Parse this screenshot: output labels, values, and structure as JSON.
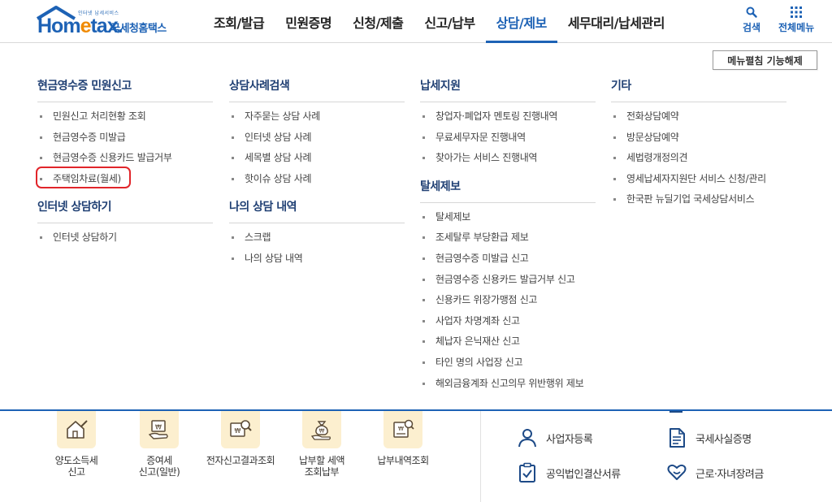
{
  "header": {
    "logo": {
      "small_text": "인터넷 납세서비스",
      "word_prefix": "Hom",
      "word_e": "e",
      "word_suffix": "tax.",
      "kr_text": "국세청홈택스"
    },
    "nav": [
      {
        "label": "조회/발급",
        "active": false
      },
      {
        "label": "민원증명",
        "active": false
      },
      {
        "label": "신청/제출",
        "active": false
      },
      {
        "label": "신고/납부",
        "active": false
      },
      {
        "label": "상담/제보",
        "active": true
      },
      {
        "label": "세무대리/납세관리",
        "active": false
      }
    ],
    "utility": {
      "search_label": "검색",
      "search_icon": "search-icon",
      "all_menu_label": "전체메뉴",
      "all_menu_icon": "grid-icon"
    }
  },
  "menu_toggle_label": "메뉴펼침 기능해제",
  "menu": {
    "col1": [
      {
        "title": "현금영수증 민원신고",
        "items": [
          "민원신고 처리현황 조회",
          "현금영수증 미발급",
          "현금영수증 신용카드 발급거부",
          "주택임차료(월세)"
        ]
      },
      {
        "title": "인터넷 상담하기",
        "items": [
          "인터넷 상담하기"
        ]
      }
    ],
    "col2": [
      {
        "title": "상담사례검색",
        "items": [
          "자주묻는 상담 사례",
          "인터넷 상담 사례",
          "세목별 상담 사례",
          "핫이슈 상담 사례"
        ]
      },
      {
        "title": "나의 상담 내역",
        "items": [
          "스크랩",
          "나의 상담 내역"
        ]
      }
    ],
    "col3": [
      {
        "title": "납세지원",
        "items": [
          "창업자·폐업자 멘토링 진행내역",
          "무료세무자문 진행내역",
          "찾아가는 서비스 진행내역"
        ]
      },
      {
        "title": "탈세제보",
        "items": [
          "탈세제보",
          "조세탈루 부당환급 제보",
          "현금영수증 미발급 신고",
          "현금영수증 신용카드 발급거부 신고",
          "신용카드 위장가맹점 신고",
          "사업자 차명계좌 신고",
          "체납자 은닉재산 신고",
          "타인 명의 사업장 신고",
          "해외금융계좌 신고의무 위반행위 제보"
        ]
      }
    ],
    "col4": [
      {
        "title": "기타",
        "items": [
          "전화상담예약",
          "방문상담예약",
          "세법령개정의견",
          "영세납세자지원단 서비스 신청/관리",
          "한국판 뉴딜기업 국세상담서비스"
        ]
      }
    ],
    "highlight_color": "#e1252a"
  },
  "bottom": {
    "services": [
      {
        "line1": "양도소득세",
        "line2": "신고",
        "icon": "house-pen-icon"
      },
      {
        "line1": "증여세",
        "line2": "신고(일반)",
        "icon": "won-hand-icon"
      },
      {
        "line1": "전자신고결과조회",
        "line2": "",
        "icon": "won-magnifier-icon"
      },
      {
        "line1": "납부할 세액",
        "line2": "조회납부",
        "icon": "money-bag-icon"
      },
      {
        "line1": "납부내역조회",
        "line2": "",
        "icon": "won-receipt-icon"
      }
    ],
    "quick": [
      {
        "label": "사업자등록",
        "icon": "person-icon"
      },
      {
        "label": "국세사실증명",
        "icon": "document-icon"
      },
      {
        "label": "공익법인결산서류",
        "icon": "clipboard-check-icon"
      },
      {
        "label": "근로·자녀장려금",
        "icon": "heart-hands-icon"
      }
    ]
  },
  "colors": {
    "brand_blue": "#1d62b5",
    "logo_orange": "#f08a00",
    "tile_bg": "#fcefcf",
    "group_title": "#1f3f73"
  }
}
